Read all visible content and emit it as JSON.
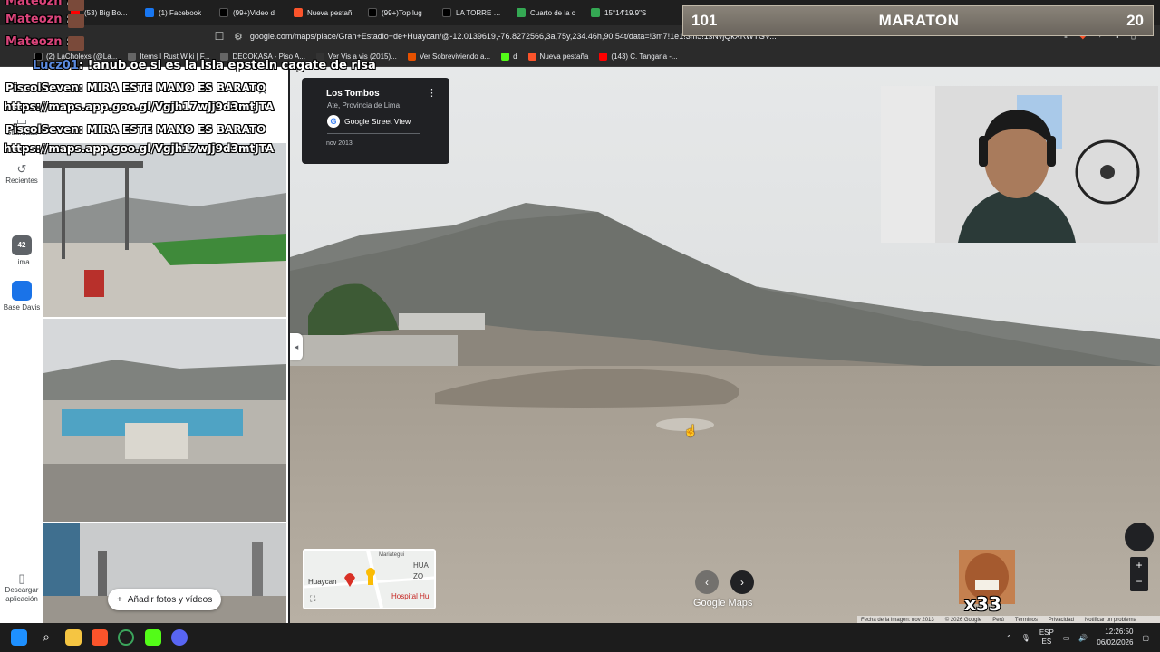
{
  "browser": {
    "tabs": [
      {
        "label": "LaCholexs S",
        "color": "#2e7d32"
      },
      {
        "label": "(53) Big Booth",
        "color": "#ff0000"
      },
      {
        "label": "(1) Facebook",
        "color": "#1877f2"
      },
      {
        "label": "(99+)Video d",
        "color": "#000000"
      },
      {
        "label": "Nueva pestañ",
        "color": "#fb542b"
      },
      {
        "label": "(99+)Top lug",
        "color": "#000000"
      },
      {
        "label": "LA TORRE eiff",
        "color": "#000000"
      },
      {
        "label": "Cuarto de la c",
        "color": "#34a853"
      },
      {
        "label": "15°14'19.9\"S",
        "color": "#34a853"
      }
    ],
    "url": "google.com/maps/place/Gran+Estadio+de+Huaycan/@-12.0139619,-76.8272566,3a,75y,234.46h,90.54t/data=!3m7!1e1!3m5!1sNvjQkXRWTGV...",
    "bookmarks": [
      {
        "label": "(2) LaCholexs (@La...",
        "color": "#000000"
      },
      {
        "label": "Items | Rust Wiki | F...",
        "color": "#444444"
      },
      {
        "label": "DECOKASA - Piso A...",
        "color": "#444444"
      },
      {
        "label": "Ver Vis a vis (2015)...",
        "color": "#222222"
      },
      {
        "label": "Ver Sobreviviendo a...",
        "color": "#e65100"
      },
      {
        "label": "d",
        "color": "#2e7d32"
      },
      {
        "label": "Nueva pestaña",
        "color": "#fb542b"
      },
      {
        "label": "(143) C. Tangana -...",
        "color": "#ff0000"
      }
    ]
  },
  "rail": {
    "saved": "Guardado",
    "recent": "Recientes",
    "lima": "Lima",
    "lima_badge": "42",
    "base": "Base Davis",
    "download": "Descargar aplicación"
  },
  "panel": {
    "add_photos": "Añadir fotos y vídeos"
  },
  "streetview_card": {
    "place": "Los Tombos",
    "location": "Ate, Provincia de Lima",
    "source": "Google Street View",
    "date": "nov 2013"
  },
  "minimap": {
    "labels": [
      "Huaycan",
      "HUA",
      "ZO",
      "Hospital Hu",
      "Mariategui"
    ]
  },
  "maps_brand": "Google Maps",
  "footer": [
    "Fecha de la imagen: nov 2013",
    "© 2026 Google",
    "Perú",
    "Términos",
    "Privacidad",
    "Notificar un problema"
  ],
  "chat": [
    {
      "user": "Mateozn",
      "text": ""
    },
    {
      "user": "Mateozn",
      "text": ""
    },
    {
      "user": "Mateozn",
      "text": ""
    },
    {
      "user": "Lucz01",
      "text": ": !anub oe si es la isla epstein cagate de risa"
    },
    {
      "user": "PiscolSeven",
      "text": ": MIRA ESTE MANO ES BARATO"
    },
    {
      "user": "",
      "text": "https://maps.app.goo.gl/Vgjh17wJj9d3mtJTA"
    },
    {
      "user": "PiscolSeven",
      "text": ": MIRA ESTE MANO ES BARATO"
    },
    {
      "user": "",
      "text": "https://maps.app.goo.gl/Vgjh17wJj9d3mtJTA"
    }
  ],
  "maraton": {
    "left": "101",
    "title": "MARATON",
    "right": "20"
  },
  "emote_count": "x33",
  "taskbar": {
    "lang1": "ESP",
    "lang2": "ES",
    "time": "12:26:50",
    "date": "06/02/2026"
  }
}
